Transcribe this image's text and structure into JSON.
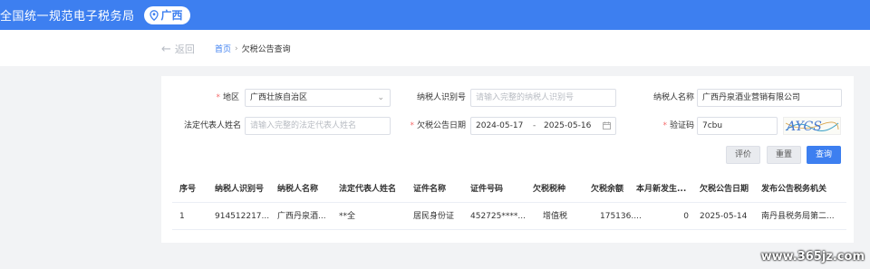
{
  "header": {
    "title": "全国统一规范电子税务局",
    "region": "广西",
    "region_icon": "location-pin-icon",
    "accent": "#3d7ff0"
  },
  "nav": {
    "back_label": "返回",
    "breadcrumb_home": "首页",
    "breadcrumb_sep": "›",
    "breadcrumb_current": "欠税公告查询"
  },
  "form": {
    "region_label": "地区",
    "region_value": "广西壮族自治区",
    "taxpayer_id_label": "纳税人识别号",
    "taxpayer_id_placeholder": "请输入完整的纳税人识别号",
    "taxpayer_name_label": "纳税人名称",
    "taxpayer_name_value": "广西丹泉酒业营销有限公司",
    "legal_rep_label": "法定代表人姓名",
    "legal_rep_placeholder": "请输入完整的法定代表人姓名",
    "notice_date_label": "欠税公告日期",
    "date_start": "2024-05-17",
    "date_sep": "-",
    "date_end": "2025-05-16",
    "captcha_label": "验证码",
    "captcha_value": "7cbu",
    "captcha_image_text": "AYCS"
  },
  "buttons": {
    "evaluate": "评价",
    "reset": "重置",
    "query": "查询"
  },
  "table": {
    "headers": [
      "序号",
      "纳税人识别号",
      "纳税人名称",
      "法定代表人姓名",
      "证件名称",
      "证件号码",
      "欠税税种",
      "欠税余额",
      "本月新发生...",
      "欠税公告日期",
      "发布公告税务机关"
    ],
    "rows": [
      [
        "1",
        "914512217...",
        "广西丹泉酒...",
        "**全",
        "居民身份证",
        "452725****...",
        "增值税",
        "175136....",
        "0",
        "2025-05-14",
        "南丹县税务局第二..."
      ]
    ]
  },
  "watermark": "www.365jz.com"
}
